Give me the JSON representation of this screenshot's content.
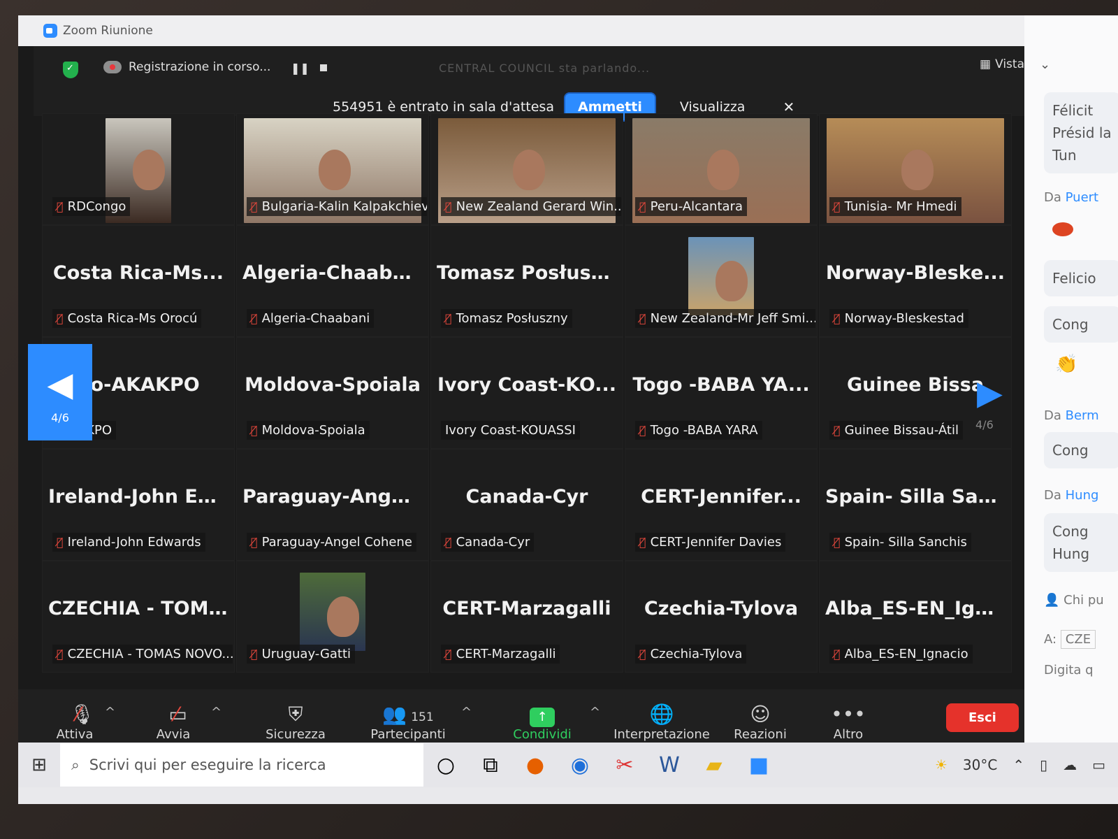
{
  "window": {
    "title": "Zoom Riunione"
  },
  "topbar": {
    "recording": "Registrazione in corso...",
    "speaking": "CENTRAL COUNCIL sta parlando...",
    "view": "Vista",
    "waiting_text": "554951 è entrato in sala d'attesa",
    "admit": "Ammetti",
    "view_btn": "Visualizza",
    "close": "✕"
  },
  "tiles": [
    {
      "big": "",
      "label": "RDCongo",
      "muted": true,
      "video": true
    },
    {
      "big": "",
      "label": "Bulgaria-Kalin Kalpakchiev",
      "muted": true,
      "video": true
    },
    {
      "big": "",
      "label": "New Zealand Gerard Win...",
      "muted": true,
      "video": true
    },
    {
      "big": "",
      "label": "Peru-Alcantara",
      "muted": true,
      "video": true
    },
    {
      "big": "",
      "label": "Tunisia- Mr Hmedi",
      "muted": true,
      "video": true
    },
    {
      "big": "Costa  Rica-Ms...",
      "label": "Costa Rica-Ms Orocú",
      "muted": true
    },
    {
      "big": "Algeria-Chaabani",
      "label": "Algeria-Chaabani",
      "muted": true
    },
    {
      "big": "Tomasz Posłuszny",
      "label": "Tomasz Posłuszny",
      "muted": true
    },
    {
      "big": "",
      "label": "New Zealand-Mr Jeff Smi...",
      "muted": true,
      "video": true
    },
    {
      "big": "Norway-Bleske...",
      "label": "Norway-Bleskestad",
      "muted": true
    },
    {
      "big": "go-AKAKPO",
      "label": "-AKAKPO",
      "muted": false
    },
    {
      "big": "Moldova-Spoiala",
      "label": "Moldova-Spoiala",
      "muted": true
    },
    {
      "big": "Ivory  Coast-KO...",
      "label": "Ivory Coast-KOUASSI",
      "muted": false
    },
    {
      "big": "Togo  -BABA  YA...",
      "label": "Togo -BABA YARA",
      "muted": true
    },
    {
      "big": "Guinee  Bissa",
      "label": "Guinee Bissau-Átil",
      "muted": true
    },
    {
      "big": "Ireland-John  Ed...",
      "label": "Ireland-John Edwards",
      "muted": true
    },
    {
      "big": "Paraguay-Angel...",
      "label": "Paraguay-Angel Cohene",
      "muted": true
    },
    {
      "big": "Canada-Cyr",
      "label": "Canada-Cyr",
      "muted": true
    },
    {
      "big": "CERT-Jennifer...",
      "label": "CERT-Jennifer Davies",
      "muted": true
    },
    {
      "big": "Spain-  Silla  San...",
      "label": "Spain- Silla Sanchis",
      "muted": true
    },
    {
      "big": "CZECHIA  -  TOM...",
      "label": "CZECHIA - TOMAS NOVO...",
      "muted": true
    },
    {
      "big": "",
      "label": "Uruguay-Gatti",
      "muted": true,
      "video": true
    },
    {
      "big": "CERT-Marzagalli",
      "label": "CERT-Marzagalli",
      "muted": true
    },
    {
      "big": "Czechia-Tylova",
      "label": "Czechia-Tylova",
      "muted": true
    },
    {
      "big": "Alba_ES-EN_Ign...",
      "label": "Alba_ES-EN_Ignacio",
      "muted": true
    }
  ],
  "paging": {
    "current": "4/6"
  },
  "toolbar": {
    "audio": "Attiva l'audio",
    "video": "Avvia video",
    "security": "Sicurezza",
    "participants": "Partecipanti",
    "participants_count": "151",
    "share": "Condividi schermo",
    "interpretation": "Interpretazione",
    "reactions": "Reazioni",
    "more": "Altro",
    "leave": "Esci"
  },
  "chat": {
    "msg1": "Félicit Présid la Tun",
    "from1_prefix": "Da",
    "from1_name": "Puert",
    "msg2": "Felicio",
    "msg3": "Cong",
    "from2_prefix": "Da",
    "from2_name": "Berm",
    "msg4": "Cong",
    "from3_prefix": "Da",
    "from3_name": "Hung",
    "msg5": "Cong Hung",
    "who": "Chi pu",
    "to_label": "A:",
    "to_value": "CZE",
    "input_placeholder": "Digita q"
  },
  "taskbar": {
    "search_placeholder": "Scrivi qui per eseguire la ricerca",
    "temperature": "30°C"
  },
  "colors": {
    "accent": "#2d8cff",
    "mute": "#e8483d",
    "share": "#2fce5f",
    "leave": "#e5322b"
  }
}
